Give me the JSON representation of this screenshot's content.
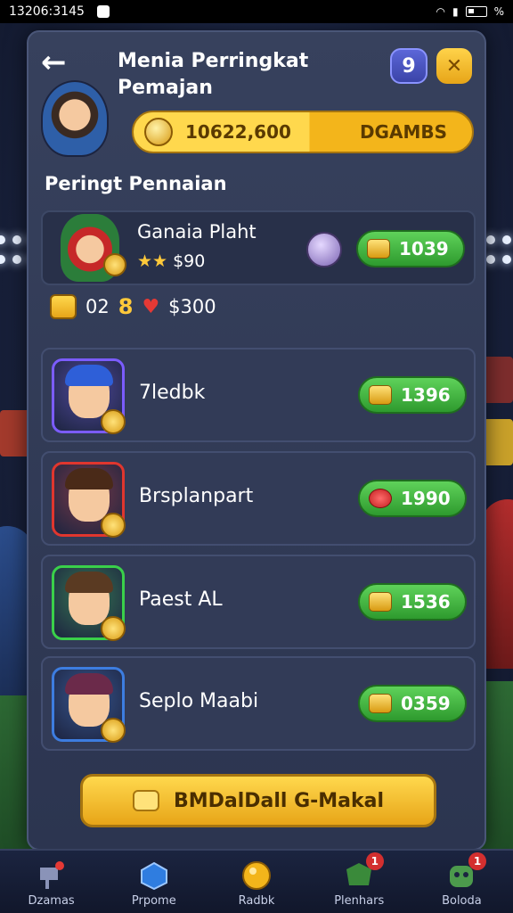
{
  "status": {
    "time": "13206:3145",
    "battery_text": "%"
  },
  "header": {
    "title": "Menia Perringkat Pemajan",
    "level": "9",
    "close_symbol": "✕"
  },
  "currency": {
    "value": "10622,600",
    "label": "DGAMBS"
  },
  "section": {
    "title": "Peringt Pennaian"
  },
  "featured": {
    "name": "Ganaia Plaht",
    "stars": "★★",
    "amount": "$90",
    "score": "1039"
  },
  "stats": {
    "count": "02",
    "rank": "8",
    "heart": "♥",
    "amount": "$300"
  },
  "players": [
    {
      "name": "7ledbk",
      "score": "1396",
      "frame_color": "#7b5cff",
      "hair_color": "#2e5fd8",
      "icon": "gold"
    },
    {
      "name": "Brsplanpart",
      "score": "1990",
      "frame_color": "#e0362e",
      "hair_color": "#4a2a18",
      "icon": "heart"
    },
    {
      "name": "Paest AL",
      "score": "1536",
      "frame_color": "#3ad04a",
      "hair_color": "#5a3a22",
      "icon": "gold"
    },
    {
      "name": "Seplo Maabi",
      "score": "0359",
      "frame_color": "#3d7de0",
      "hair_color": "#6b2a4a",
      "icon": "gold"
    }
  ],
  "cta": {
    "label": "BMDalDall G-Makal"
  },
  "bottom_nav": [
    {
      "label": "Dzamas",
      "badge": ""
    },
    {
      "label": "Prpome",
      "badge": ""
    },
    {
      "label": "Radbk",
      "badge": ""
    },
    {
      "label": "Plenhars",
      "badge": "1"
    },
    {
      "label": "Boloda",
      "badge": "1"
    }
  ]
}
